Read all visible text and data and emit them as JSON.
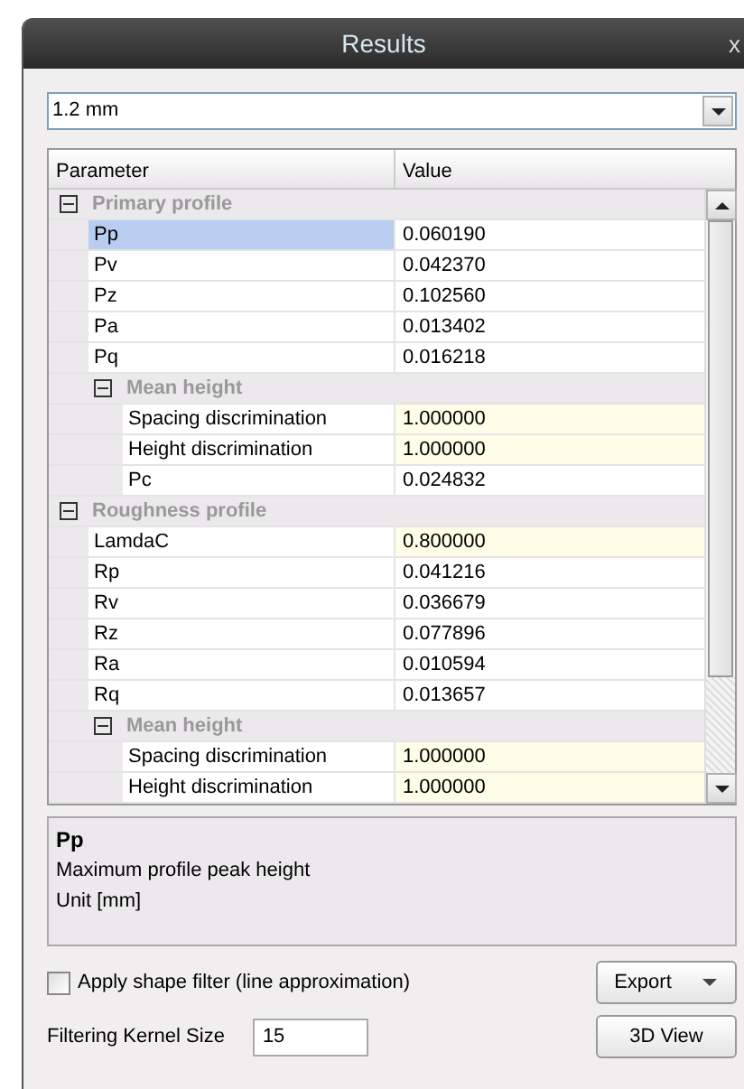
{
  "window": {
    "title": "Results",
    "close": "x"
  },
  "combo": {
    "value": "1.2 mm"
  },
  "tree": {
    "columns": [
      "Parameter",
      "Value"
    ],
    "rows": [
      {
        "kind": "group",
        "label": "Primary profile",
        "expanded": true,
        "children": [
          {
            "kind": "item",
            "label": "Pp",
            "value": "0.060190",
            "selected": true,
            "editable": false
          },
          {
            "kind": "item",
            "label": "Pv",
            "value": "0.042370",
            "selected": false,
            "editable": false
          },
          {
            "kind": "item",
            "label": "Pz",
            "value": "0.102560",
            "selected": false,
            "editable": false
          },
          {
            "kind": "item",
            "label": "Pa",
            "value": "0.013402",
            "selected": false,
            "editable": false
          },
          {
            "kind": "item",
            "label": "Pq",
            "value": "0.016218",
            "selected": false,
            "editable": false
          },
          {
            "kind": "group",
            "label": "Mean height",
            "expanded": true,
            "children": [
              {
                "kind": "item",
                "label": "Spacing discrimination",
                "value": "1.000000",
                "selected": false,
                "editable": true
              },
              {
                "kind": "item",
                "label": "Height discrimination",
                "value": "1.000000",
                "selected": false,
                "editable": true
              },
              {
                "kind": "item",
                "label": "Pc",
                "value": "0.024832",
                "selected": false,
                "editable": false
              }
            ]
          }
        ]
      },
      {
        "kind": "group",
        "label": "Roughness profile",
        "expanded": true,
        "children": [
          {
            "kind": "item",
            "label": "LamdaC",
            "value": "0.800000",
            "selected": false,
            "editable": true
          },
          {
            "kind": "item",
            "label": "Rp",
            "value": "0.041216",
            "selected": false,
            "editable": false
          },
          {
            "kind": "item",
            "label": "Rv",
            "value": "0.036679",
            "selected": false,
            "editable": false
          },
          {
            "kind": "item",
            "label": "Rz",
            "value": "0.077896",
            "selected": false,
            "editable": false
          },
          {
            "kind": "item",
            "label": "Ra",
            "value": "0.010594",
            "selected": false,
            "editable": false
          },
          {
            "kind": "item",
            "label": "Rq",
            "value": "0.013657",
            "selected": false,
            "editable": false
          },
          {
            "kind": "group",
            "label": "Mean height",
            "expanded": true,
            "children": [
              {
                "kind": "item",
                "label": "Spacing discrimination",
                "value": "1.000000",
                "selected": false,
                "editable": true
              },
              {
                "kind": "item",
                "label": "Height discrimination",
                "value": "1.000000",
                "selected": false,
                "editable": true
              }
            ]
          }
        ]
      }
    ]
  },
  "description": {
    "title": "Pp",
    "lines": [
      "Maximum profile peak height",
      "Unit [mm]"
    ]
  },
  "shape_filter": {
    "label": "Apply shape filter (line approximation)",
    "checked": false
  },
  "kernel": {
    "label": "Filtering Kernel Size",
    "value": "15"
  },
  "buttons": [
    {
      "kind": "menu",
      "label": "Export"
    },
    {
      "kind": "plain",
      "label": "3D View"
    }
  ]
}
